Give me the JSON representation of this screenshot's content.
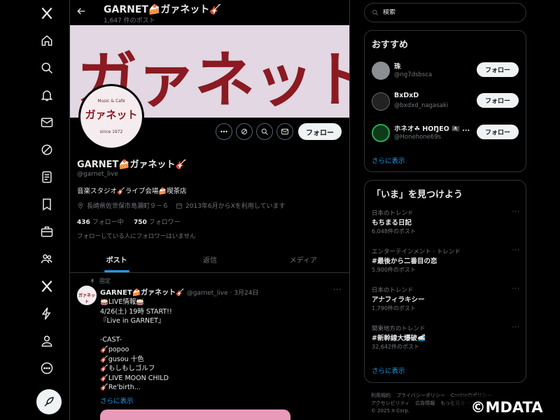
{
  "profile": {
    "top_name": "GARNET🍰ガァネット🎸",
    "post_count": "1,647 件のポスト",
    "banner_text": "ガァネット",
    "avatar": {
      "small": "Music & Café",
      "main": "ガァネット",
      "since": "since 1972"
    },
    "name": "GARNET🍰ガァネット🎸",
    "handle": "@garnet_live",
    "bio": "音楽スタジオ🎸ライブ会場🍰喫茶店",
    "location": "長崎県佐世保市島瀬町９－６",
    "joined": "2013年6月からXを利用しています",
    "following_count": "436",
    "following_label": "フォロー中",
    "followers_count": "750",
    "followers_label": "フォロワー",
    "followers_note": "フォローしている人にフォロワーはいません",
    "follow_button": "フォロー"
  },
  "tabs": [
    {
      "label": "ポスト"
    },
    {
      "label": "返信"
    },
    {
      "label": "メディア"
    }
  ],
  "post": {
    "pinned_label": "固定",
    "author": "GARNET🍰ガァネット🎸",
    "meta": "@garnet_live · 3月24日",
    "avatar_text": "ガァネット",
    "body": "🥁LIVE情報🥁\n4/26(土) 19時 START!!\n『Live in GARNET』\n\n-CAST-\n🎸popoo\n🎸gusou 十色\n🎸もしもしゴルフ\n🎸LIVE MOON CHILD\n🎸Re'birth...",
    "show_more": "さらに表示"
  },
  "search": {
    "placeholder": "検索"
  },
  "recommend": {
    "title": "おすすめ",
    "items": [
      {
        "name": "珠",
        "handle": "@ng7dsbsca",
        "button": "フォロー"
      },
      {
        "name": "BxDxD",
        "handle": "@bxdxd_nagasaki",
        "button": "フォロー"
      },
      {
        "name": "ホネオ☘ HOŊEO 🏴‍☠️ ...",
        "handle": "@Honehone69s",
        "button": "フォロー"
      }
    ],
    "show_more": "さらに表示"
  },
  "trends": {
    "title": "「いま」を見つけよう",
    "items": [
      {
        "context": "日本のトレンド",
        "name": "もちまる日記",
        "count": "6,048件のポスト"
      },
      {
        "context": "エンターテインメント · トレンド",
        "name": "#最後から二番目の恋",
        "count": "5,900件のポスト"
      },
      {
        "context": "日本のトレンド",
        "name": "アナフィラキシー",
        "count": "1,790件のポスト"
      },
      {
        "context": "関東地方のトレンド",
        "name": "#新幹線大爆破🚅",
        "count": "32,642件のポスト"
      }
    ],
    "show_more": "さらに表示"
  },
  "footer": {
    "line1": [
      "利用規約",
      "プライバシーポリシー",
      "Cookieのポリシー"
    ],
    "line2": [
      "アクセシビリティ",
      "広告情報",
      "もっと見る ···"
    ],
    "copyright": "© 2025 X Corp."
  },
  "watermark": "©MDATA",
  "colors": {
    "accent": "#1d9bf0",
    "banner_red": "#8b1a22",
    "banner_bg": "#e2d7e2"
  }
}
